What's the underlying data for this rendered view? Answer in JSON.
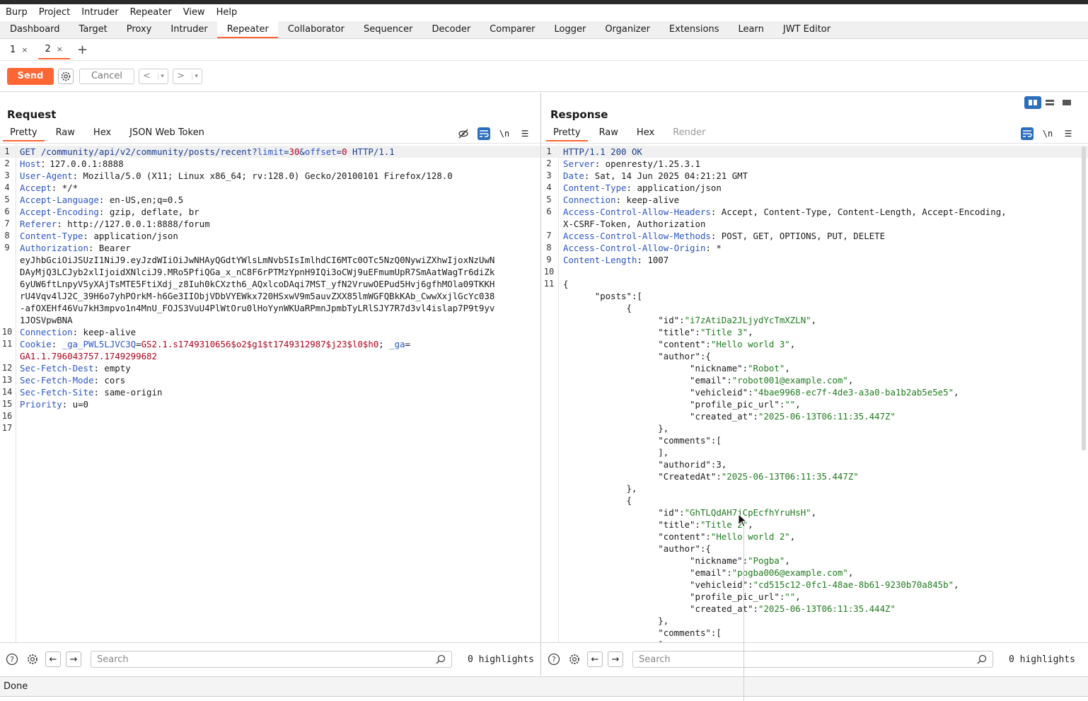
{
  "menu": [
    "Burp",
    "Project",
    "Intruder",
    "Repeater",
    "View",
    "Help"
  ],
  "main_tabs": [
    {
      "label": "Dashboard",
      "active": false
    },
    {
      "label": "Target",
      "active": false
    },
    {
      "label": "Proxy",
      "active": false
    },
    {
      "label": "Intruder",
      "active": false
    },
    {
      "label": "Repeater",
      "active": true
    },
    {
      "label": "Collaborator",
      "active": false
    },
    {
      "label": "Sequencer",
      "active": false
    },
    {
      "label": "Decoder",
      "active": false
    },
    {
      "label": "Comparer",
      "active": false
    },
    {
      "label": "Logger",
      "active": false
    },
    {
      "label": "Organizer",
      "active": false
    },
    {
      "label": "Extensions",
      "active": false
    },
    {
      "label": "Learn",
      "active": false
    },
    {
      "label": "JWT Editor",
      "active": false
    }
  ],
  "repeater_tabs": [
    {
      "label": "1",
      "active": false
    },
    {
      "label": "2",
      "active": true
    }
  ],
  "toolbar": {
    "send": "Send",
    "cancel": "Cancel",
    "back": "<",
    "forward": ">"
  },
  "request": {
    "title": "Request",
    "tabs": [
      "Pretty",
      "Raw",
      "Hex",
      "JSON Web Token"
    ],
    "lines": [
      {
        "n": "1",
        "parts": [
          [
            "k",
            "GET /community/api/v2/community/posts/recent?"
          ],
          [
            "p",
            "limit"
          ],
          [
            "k",
            "="
          ],
          [
            "v",
            "30"
          ],
          [
            "k",
            "&"
          ],
          [
            "p",
            "offset"
          ],
          [
            "k",
            "="
          ],
          [
            "v",
            "0"
          ],
          [
            "k",
            " HTTP/1.1"
          ]
        ]
      },
      {
        "n": "2",
        "parts": [
          [
            "p",
            "Host"
          ],
          [
            "",
            "：127.0.0.1:8888"
          ]
        ]
      },
      {
        "n": "3",
        "parts": [
          [
            "p",
            "User-Agent"
          ],
          [
            "",
            ": Mozilla/5.0 (X11; Linux x86_64; rv:128.0) Gecko/20100101 Firefox/128.0"
          ]
        ]
      },
      {
        "n": "4",
        "parts": [
          [
            "p",
            "Accept"
          ],
          [
            "",
            ": */*"
          ]
        ]
      },
      {
        "n": "5",
        "parts": [
          [
            "p",
            "Accept-Language"
          ],
          [
            "",
            ": en-US,en;q=0.5"
          ]
        ]
      },
      {
        "n": "6",
        "parts": [
          [
            "p",
            "Accept-Encoding"
          ],
          [
            "",
            ": gzip, deflate, br"
          ]
        ]
      },
      {
        "n": "7",
        "parts": [
          [
            "p",
            "Referer"
          ],
          [
            "",
            ": http://127.0.0.1:8888/forum"
          ]
        ]
      },
      {
        "n": "8",
        "parts": [
          [
            "p",
            "Content-Type"
          ],
          [
            "",
            ": application/json"
          ]
        ]
      },
      {
        "n": "9",
        "parts": [
          [
            "p",
            "Authorization"
          ],
          [
            "",
            ": Bearer"
          ]
        ]
      },
      {
        "n": "",
        "parts": [
          [
            "",
            "eyJhbGciOiJSUzI1NiJ9.eyJzdWIiOiJwNHAyQGdtYWlsLmNvbSIsImlhdCI6MTc0OTc5NzQ0NywiZXhwIjoxNzUwN"
          ]
        ]
      },
      {
        "n": "",
        "parts": [
          [
            "",
            "DAyMjQ3LCJyb2xlIjoidXNlciJ9.MRo5PfiQGa_x_nC8F6rPTMzYpnH9IQi3oCWj9uEFmumUpR7SmAatWagTr6diZk"
          ]
        ]
      },
      {
        "n": "",
        "parts": [
          [
            "",
            "6yUW6ftLnpyV5yXAjTsMTE5FtiXdj_z8Iuh0kCXzth6_AQxlcoDAqi7MST_yfN2VruwOEPud5Hvj6gfhMOla09TKKH"
          ]
        ]
      },
      {
        "n": "",
        "parts": [
          [
            "",
            "rU4Vqv4lJ2C_39H6o7yhPOrkM-h6Ge3IIObjVDbVYEWkx720HSxwV9m5auvZXX85lmWGFQBkKAb_CwwXxjlGcYc038"
          ]
        ]
      },
      {
        "n": "",
        "parts": [
          [
            "",
            "-afOXEHf46Vu7kH3mpvo1n4MnU_FOJS3VuU4PlWtOru0lHoYynWKUaRPmnJpmbTyLRlSJY7R7d3vl4islap7P9t9yv"
          ]
        ]
      },
      {
        "n": "",
        "parts": [
          [
            "",
            "1JOSVpwBNA"
          ]
        ]
      },
      {
        "n": "10",
        "parts": [
          [
            "p",
            "Connection"
          ],
          [
            "",
            ": keep-alive"
          ]
        ]
      },
      {
        "n": "11",
        "parts": [
          [
            "p",
            "Cookie"
          ],
          [
            "",
            ": "
          ],
          [
            "p",
            "_ga_PWL5LJVC3Q"
          ],
          [
            "",
            "="
          ],
          [
            "v",
            "GS2.1.s1749310656$o2$g1$t1749312987$j23$l0$h0"
          ],
          [
            "",
            "; "
          ],
          [
            "p",
            "_ga"
          ],
          [
            "",
            "="
          ]
        ]
      },
      {
        "n": "",
        "parts": [
          [
            "v",
            "GA1.1.796043757.1749299682"
          ]
        ]
      },
      {
        "n": "12",
        "parts": [
          [
            "p",
            "Sec-Fetch-Dest"
          ],
          [
            "",
            ": empty"
          ]
        ]
      },
      {
        "n": "13",
        "parts": [
          [
            "p",
            "Sec-Fetch-Mode"
          ],
          [
            "",
            ": cors"
          ]
        ]
      },
      {
        "n": "14",
        "parts": [
          [
            "p",
            "Sec-Fetch-Site"
          ],
          [
            "",
            ": same-origin"
          ]
        ]
      },
      {
        "n": "15",
        "parts": [
          [
            "p",
            "Priority"
          ],
          [
            "",
            ": u=0"
          ]
        ]
      },
      {
        "n": "16",
        "parts": [
          [
            "",
            ""
          ]
        ]
      },
      {
        "n": "17",
        "parts": [
          [
            "",
            ""
          ]
        ]
      }
    ],
    "search_placeholder": "Search",
    "highlights": "0 highlights"
  },
  "response": {
    "title": "Response",
    "tabs": [
      "Pretty",
      "Raw",
      "Hex",
      "Render"
    ],
    "lines": [
      {
        "n": "1",
        "parts": [
          [
            "k",
            "HTTP/1.1 200 OK"
          ]
        ]
      },
      {
        "n": "2",
        "parts": [
          [
            "p",
            "Server"
          ],
          [
            "",
            ": openresty/1.25.3.1"
          ]
        ]
      },
      {
        "n": "3",
        "parts": [
          [
            "p",
            "Date"
          ],
          [
            "",
            ": Sat, 14 Jun 2025 04:21:21 GMT"
          ]
        ]
      },
      {
        "n": "4",
        "parts": [
          [
            "p",
            "Content-Type"
          ],
          [
            "",
            ": application/json"
          ]
        ]
      },
      {
        "n": "5",
        "parts": [
          [
            "p",
            "Connection"
          ],
          [
            "",
            ": keep-alive"
          ]
        ]
      },
      {
        "n": "6",
        "parts": [
          [
            "p",
            "Access-Control-Allow-Headers"
          ],
          [
            "",
            ": Accept, Content-Type, Content-Length, Accept-Encoding,"
          ]
        ]
      },
      {
        "n": "",
        "parts": [
          [
            "",
            "X-CSRF-Token, Authorization"
          ]
        ]
      },
      {
        "n": "7",
        "parts": [
          [
            "p",
            "Access-Control-Allow-Methods"
          ],
          [
            "",
            ": POST, GET, OPTIONS, PUT, DELETE"
          ]
        ]
      },
      {
        "n": "8",
        "parts": [
          [
            "p",
            "Access-Control-Allow-Origin"
          ],
          [
            "",
            ": *"
          ]
        ]
      },
      {
        "n": "9",
        "parts": [
          [
            "p",
            "Content-Length"
          ],
          [
            "",
            ": 1007"
          ]
        ]
      },
      {
        "n": "10",
        "parts": [
          [
            "",
            ""
          ]
        ]
      },
      {
        "n": "11",
        "parts": [
          [
            "",
            "{"
          ]
        ]
      },
      {
        "n": "",
        "parts": [
          [
            "",
            "      \"posts\":["
          ]
        ]
      },
      {
        "n": "",
        "parts": [
          [
            "",
            "            {"
          ]
        ]
      },
      {
        "n": "",
        "parts": [
          [
            "",
            "                  \"id\":"
          ],
          [
            "s",
            "\"i7zAtiDa2JLjydYcTmXZLN\""
          ],
          [
            "",
            ","
          ]
        ]
      },
      {
        "n": "",
        "parts": [
          [
            "",
            "                  \"title\":"
          ],
          [
            "s",
            "\"Title 3\""
          ],
          [
            "",
            ","
          ]
        ]
      },
      {
        "n": "",
        "parts": [
          [
            "",
            "                  \"content\":"
          ],
          [
            "s",
            "\"Hello world 3\""
          ],
          [
            "",
            ","
          ]
        ]
      },
      {
        "n": "",
        "parts": [
          [
            "",
            "                  \"author\":{"
          ]
        ]
      },
      {
        "n": "",
        "parts": [
          [
            "",
            "                        \"nickname\":"
          ],
          [
            "s",
            "\"Robot\""
          ],
          [
            "",
            ","
          ]
        ]
      },
      {
        "n": "",
        "parts": [
          [
            "",
            "                        \"email\":"
          ],
          [
            "s",
            "\"robot001@example.com\""
          ],
          [
            "",
            ","
          ]
        ]
      },
      {
        "n": "",
        "parts": [
          [
            "",
            "                        \"vehicleid\":"
          ],
          [
            "s",
            "\"4bae9968-ec7f-4de3-a3a0-ba1b2ab5e5e5\""
          ],
          [
            "",
            ","
          ]
        ]
      },
      {
        "n": "",
        "parts": [
          [
            "",
            "                        \"profile_pic_url\":"
          ],
          [
            "s",
            "\"\""
          ],
          [
            "",
            ","
          ]
        ]
      },
      {
        "n": "",
        "parts": [
          [
            "",
            "                        \"created_at\":"
          ],
          [
            "s",
            "\"2025-06-13T06:11:35.447Z\""
          ]
        ]
      },
      {
        "n": "",
        "parts": [
          [
            "",
            "                  },"
          ]
        ]
      },
      {
        "n": "",
        "parts": [
          [
            "",
            "                  \"comments\":["
          ]
        ]
      },
      {
        "n": "",
        "parts": [
          [
            "",
            "                  ],"
          ]
        ]
      },
      {
        "n": "",
        "parts": [
          [
            "",
            "                  \"authorid\":3,"
          ]
        ]
      },
      {
        "n": "",
        "parts": [
          [
            "",
            "                  \"CreatedAt\":"
          ],
          [
            "s",
            "\"2025-06-13T06:11:35.447Z\""
          ]
        ]
      },
      {
        "n": "",
        "parts": [
          [
            "",
            "            },"
          ]
        ]
      },
      {
        "n": "",
        "parts": [
          [
            "",
            "            {"
          ]
        ]
      },
      {
        "n": "",
        "parts": [
          [
            "",
            "                  \"id\":"
          ],
          [
            "s",
            "\"GhTLQdAH7jCpEcfhYruHsH\""
          ],
          [
            "",
            ","
          ]
        ]
      },
      {
        "n": "",
        "parts": [
          [
            "",
            "                  \"title\":"
          ],
          [
            "s",
            "\"Title 2\""
          ],
          [
            "",
            ","
          ]
        ]
      },
      {
        "n": "",
        "parts": [
          [
            "",
            "                  \"content\":"
          ],
          [
            "s",
            "\"Hello world 2\""
          ],
          [
            "",
            ","
          ]
        ]
      },
      {
        "n": "",
        "parts": [
          [
            "",
            "                  \"author\":{"
          ]
        ]
      },
      {
        "n": "",
        "parts": [
          [
            "",
            "                        \"nickname\":"
          ],
          [
            "s",
            "\"Pogba\""
          ],
          [
            "",
            ","
          ]
        ]
      },
      {
        "n": "",
        "parts": [
          [
            "",
            "                        \"email\":"
          ],
          [
            "s",
            "\"pogba006@example.com\""
          ],
          [
            "",
            ","
          ]
        ]
      },
      {
        "n": "",
        "parts": [
          [
            "",
            "                        \"vehicleid\":"
          ],
          [
            "s",
            "\"cd515c12-0fc1-48ae-8b61-9230b70a845b\""
          ],
          [
            "",
            ","
          ]
        ]
      },
      {
        "n": "",
        "parts": [
          [
            "",
            "                        \"profile_pic_url\":"
          ],
          [
            "s",
            "\"\""
          ],
          [
            "",
            ","
          ]
        ]
      },
      {
        "n": "",
        "parts": [
          [
            "",
            "                        \"created_at\":"
          ],
          [
            "s",
            "\"2025-06-13T06:11:35.444Z\""
          ]
        ]
      },
      {
        "n": "",
        "parts": [
          [
            "",
            "                  },"
          ]
        ]
      },
      {
        "n": "",
        "parts": [
          [
            "",
            "                  \"comments\":["
          ]
        ]
      },
      {
        "n": "",
        "parts": [
          [
            "",
            "                  ]"
          ]
        ]
      }
    ],
    "search_placeholder": "Search",
    "highlights": "0 highlights"
  },
  "status": "Done",
  "colors": {
    "accent": "#ff6633",
    "toggle": "#2a6ebf",
    "header_name": "#2b55c6",
    "param_value": "#b0001c",
    "json_string": "#1f7a1f"
  }
}
